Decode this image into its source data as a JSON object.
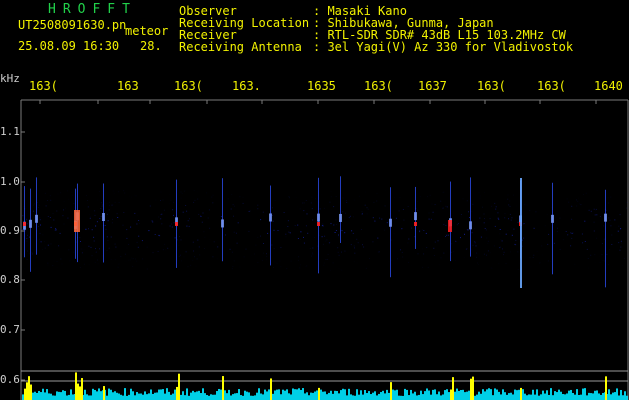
{
  "header": {
    "app_title": "HROFFT",
    "filename": "UT2508091630.pn",
    "mode": "meteor",
    "datetime": "25.08.09 16:30",
    "count": "28."
  },
  "station": {
    "rows": [
      {
        "label": "Observer",
        "value": ": Masaki Kano"
      },
      {
        "label": "Receiving Location",
        "value": ": Shibukawa, Gunma, Japan"
      },
      {
        "label": "Receiver",
        "value": ": RTL-SDR SDR# 43dB L15 103.2MHz CW"
      },
      {
        "label": "Receiving Antenna",
        "value": ": 3el Yagi(V) Az 330 for Vladivostok"
      }
    ]
  },
  "axes": {
    "x_ticks": [
      "163(",
      "163",
      "163(",
      "163.",
      "1635",
      "163(",
      "1637",
      "163(",
      "163(",
      "1640"
    ],
    "y_unit": "kHz",
    "y_ticks": [
      "1.1",
      "1.0",
      "0.9",
      "0.8",
      "0.7",
      "0.6"
    ]
  },
  "colors": {
    "header_yellow": "#f2f200",
    "title_green": "#21d14a",
    "spectrum_bars": "#ffff00",
    "spectrum_base": "#00e5ff",
    "noise_blue": "#1a2bd8",
    "echo_red": "#ff2020"
  }
}
